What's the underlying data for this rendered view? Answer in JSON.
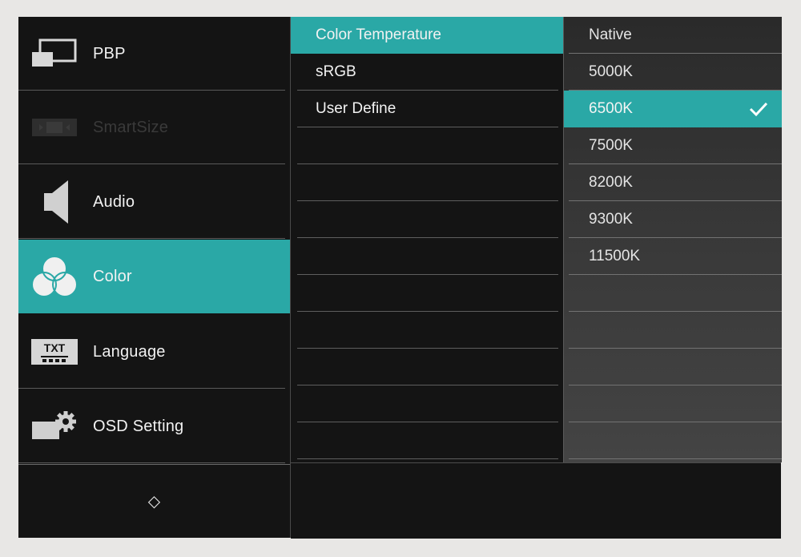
{
  "main_menu": {
    "items": [
      {
        "label": "PBP",
        "icon": "pbp-icon",
        "state": "normal"
      },
      {
        "label": "SmartSize",
        "icon": "smartsize-icon",
        "state": "disabled"
      },
      {
        "label": "Audio",
        "icon": "speaker-icon",
        "state": "normal"
      },
      {
        "label": "Color",
        "icon": "color-circles-icon",
        "state": "selected"
      },
      {
        "label": "Language",
        "icon": "txt-icon",
        "state": "normal"
      },
      {
        "label": "OSD Setting",
        "icon": "osd-gear-icon",
        "state": "normal"
      }
    ],
    "nav_glyph": "◇"
  },
  "color_submenu": {
    "items": [
      "Color Temperature",
      "sRGB",
      "User Define"
    ],
    "selected": "Color Temperature"
  },
  "color_temperature": {
    "options": [
      "Native",
      "5000K",
      "6500K",
      "7500K",
      "8200K",
      "9300K",
      "11500K"
    ],
    "selected": "6500K"
  },
  "colors": {
    "accent": "#2aa8a6",
    "background": "#141414",
    "text": "#f2f2f2",
    "disabled_text": "#3a3a3a"
  }
}
